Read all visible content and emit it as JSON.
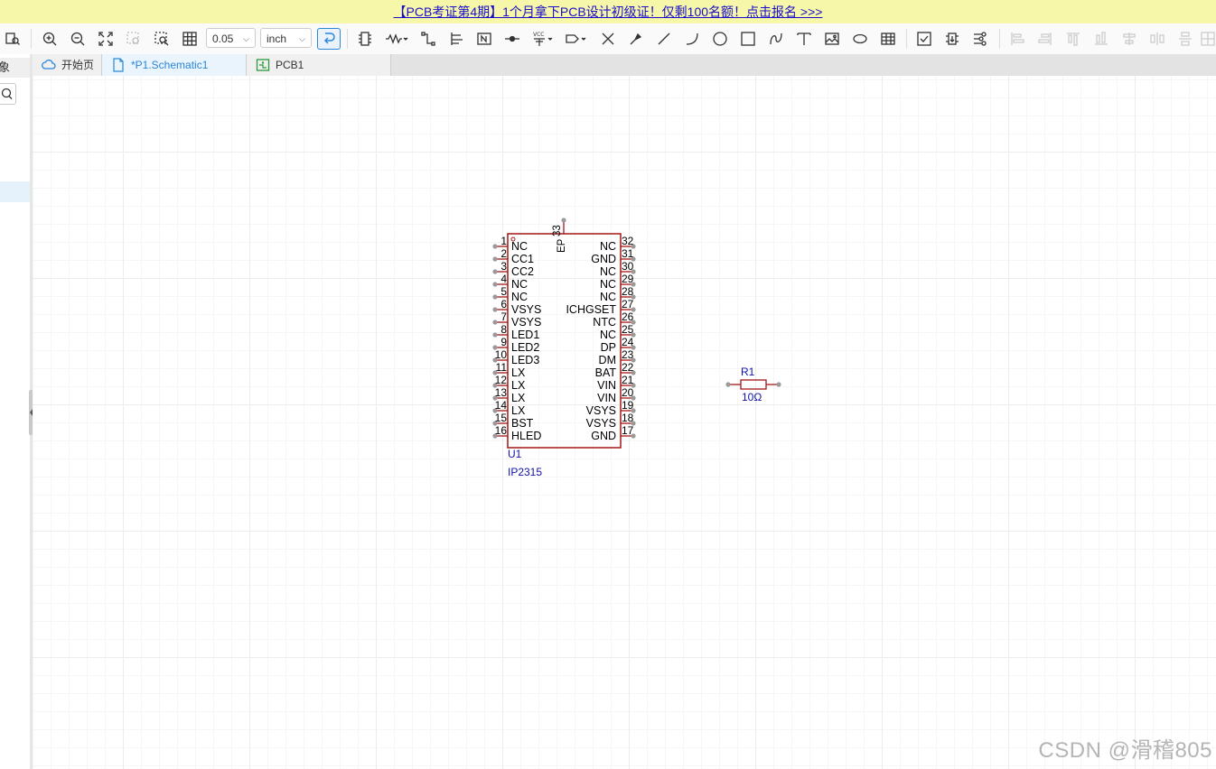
{
  "banner": {
    "text": "【PCB考证第4期】1个月拿下PCB设计初级证！仅剩100名额！点击报名 >>>"
  },
  "toolbar": {
    "grid_value": "0.05",
    "unit_value": "inch",
    "accent_color": "#2b86d8"
  },
  "left_panel": {
    "header": "象"
  },
  "tabs": [
    {
      "label": "开始页",
      "icon": "home-cloud-icon",
      "active": false
    },
    {
      "label": "*P1.Schematic1",
      "icon": "schematic-doc-icon",
      "active": true
    },
    {
      "label": "PCB1",
      "icon": "pcb-doc-icon",
      "active": false
    }
  ],
  "schematic": {
    "colors": {
      "body": "#a31515",
      "pin_text": "#000000",
      "designator": "#1111aa",
      "pin_end": "#888888"
    },
    "u1": {
      "designator": "U1",
      "value": "IP2315",
      "ep_pin": {
        "name": "EP",
        "number": "33"
      },
      "left_pins": [
        {
          "number": "1",
          "name": "NC"
        },
        {
          "number": "2",
          "name": "CC1"
        },
        {
          "number": "3",
          "name": "CC2"
        },
        {
          "number": "4",
          "name": "NC"
        },
        {
          "number": "5",
          "name": "NC"
        },
        {
          "number": "6",
          "name": "VSYS"
        },
        {
          "number": "7",
          "name": "VSYS"
        },
        {
          "number": "8",
          "name": "LED1"
        },
        {
          "number": "9",
          "name": "LED2"
        },
        {
          "number": "10",
          "name": "LED3"
        },
        {
          "number": "11",
          "name": "LX"
        },
        {
          "number": "12",
          "name": "LX"
        },
        {
          "number": "13",
          "name": "LX"
        },
        {
          "number": "14",
          "name": "LX"
        },
        {
          "number": "15",
          "name": "BST"
        },
        {
          "number": "16",
          "name": "HLED"
        }
      ],
      "right_pins": [
        {
          "number": "32",
          "name": "NC"
        },
        {
          "number": "31",
          "name": "GND"
        },
        {
          "number": "30",
          "name": "NC"
        },
        {
          "number": "29",
          "name": "NC"
        },
        {
          "number": "28",
          "name": "NC"
        },
        {
          "number": "27",
          "name": "ICHGSET"
        },
        {
          "number": "26",
          "name": "NTC"
        },
        {
          "number": "25",
          "name": "NC"
        },
        {
          "number": "24",
          "name": "DP"
        },
        {
          "number": "23",
          "name": "DM"
        },
        {
          "number": "22",
          "name": "BAT"
        },
        {
          "number": "21",
          "name": "VIN"
        },
        {
          "number": "20",
          "name": "VIN"
        },
        {
          "number": "19",
          "name": "VSYS"
        },
        {
          "number": "18",
          "name": "VSYS"
        },
        {
          "number": "17",
          "name": "GND"
        }
      ]
    },
    "r1": {
      "designator": "R1",
      "value": "10Ω"
    }
  },
  "watermark": "CSDN @滑稽805"
}
